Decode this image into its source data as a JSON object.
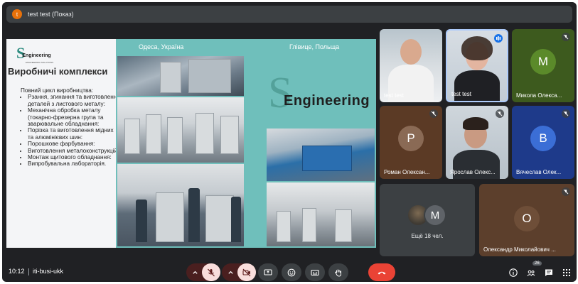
{
  "meeting": {
    "title": "test test (Показ)",
    "avatar_letter": "t",
    "time": "10:12",
    "code": "iti-busi-ukk",
    "participants_count": "26"
  },
  "slide": {
    "logo_s": "S",
    "logo_text": "Engineering",
    "logo_sub": "ENGINEERING SOLUTIONS",
    "heading": "Виробничі комплекси",
    "intro": "Повний цикл виробництва:",
    "bullets": [
      "Рзання, згинання та виготовлення деталей з листового металу:",
      "Механічна обробка металу (токарно-фрезерна група та зварювальне обладнання:",
      "Порізка та виготовлення мідних та алюмінієвих шин:",
      "Порошкове фарбування:",
      "Виготовлення металоконструкцій:",
      "Монтаж щитового обладнання:",
      "Випробувальна лабораторія."
    ],
    "city_left": "Одеса, Україна",
    "city_right": "Глівице, Польща",
    "big_logo_s": "S",
    "big_logo_text": "Engineering"
  },
  "tiles": [
    {
      "name": "test test",
      "muted": false
    },
    {
      "name": "test test",
      "muted": false,
      "speaking": true
    },
    {
      "name": "Микола Олекса...",
      "letter": "М",
      "color": "#5b8a2a",
      "muted": true
    },
    {
      "name": "Роман Олексан...",
      "letter": "Р",
      "color": "#8a6a55",
      "muted": true
    },
    {
      "name": "Ярослав Олекс...",
      "muted": true
    },
    {
      "name": "Вячеслав Олек...",
      "letter": "В",
      "color": "#3b6ed6",
      "muted": true
    },
    {
      "more_label": "Ещё 18 чел.",
      "letter": "М"
    },
    {
      "name": "Олександр Миколайович ...",
      "letter": "О",
      "color": "#6e4e38",
      "muted": true
    }
  ],
  "colors": {
    "bg": "#202124",
    "bar": "#3c4043",
    "mic_off_red": "#f9dedc",
    "end_call": "#ea4335",
    "teal": "#6fbfbb"
  }
}
